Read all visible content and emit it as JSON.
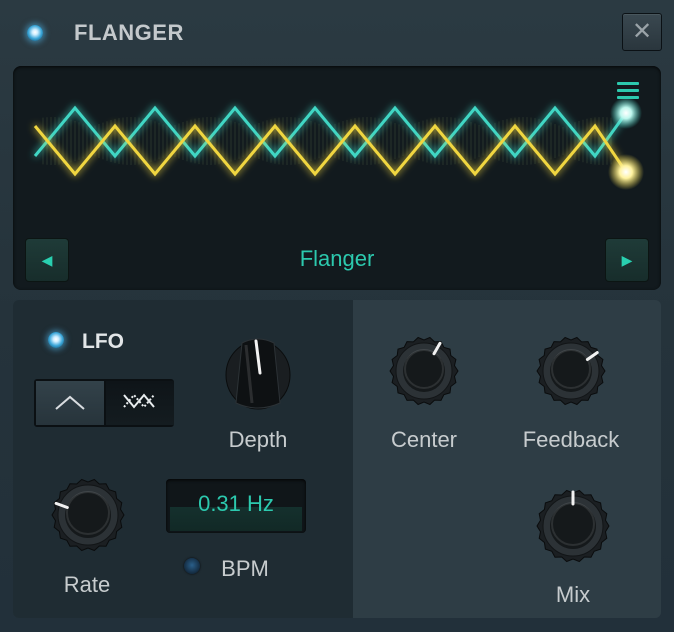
{
  "header": {
    "title": "FLANGER",
    "close_label": "✕"
  },
  "display": {
    "preset_name": "Flanger",
    "prev_label": "◀",
    "next_label": "▶"
  },
  "lfo": {
    "label": "LFO",
    "shapes": [
      "triangle",
      "ramp"
    ],
    "selected_shape": "ramp",
    "enabled": true
  },
  "controls": {
    "depth": {
      "label": "Depth"
    },
    "center": {
      "label": "Center"
    },
    "feedback": {
      "label": "Feedback"
    },
    "rate": {
      "label": "Rate"
    },
    "mix": {
      "label": "Mix"
    }
  },
  "rate_readout": "0.31 Hz",
  "bpm": {
    "label": "BPM",
    "enabled": false
  },
  "colors": {
    "accent": "#2cc9ae",
    "wave_cyan": "#3fd6c4",
    "wave_yellow": "#f0d640",
    "led_on": "#3aa6d8"
  }
}
